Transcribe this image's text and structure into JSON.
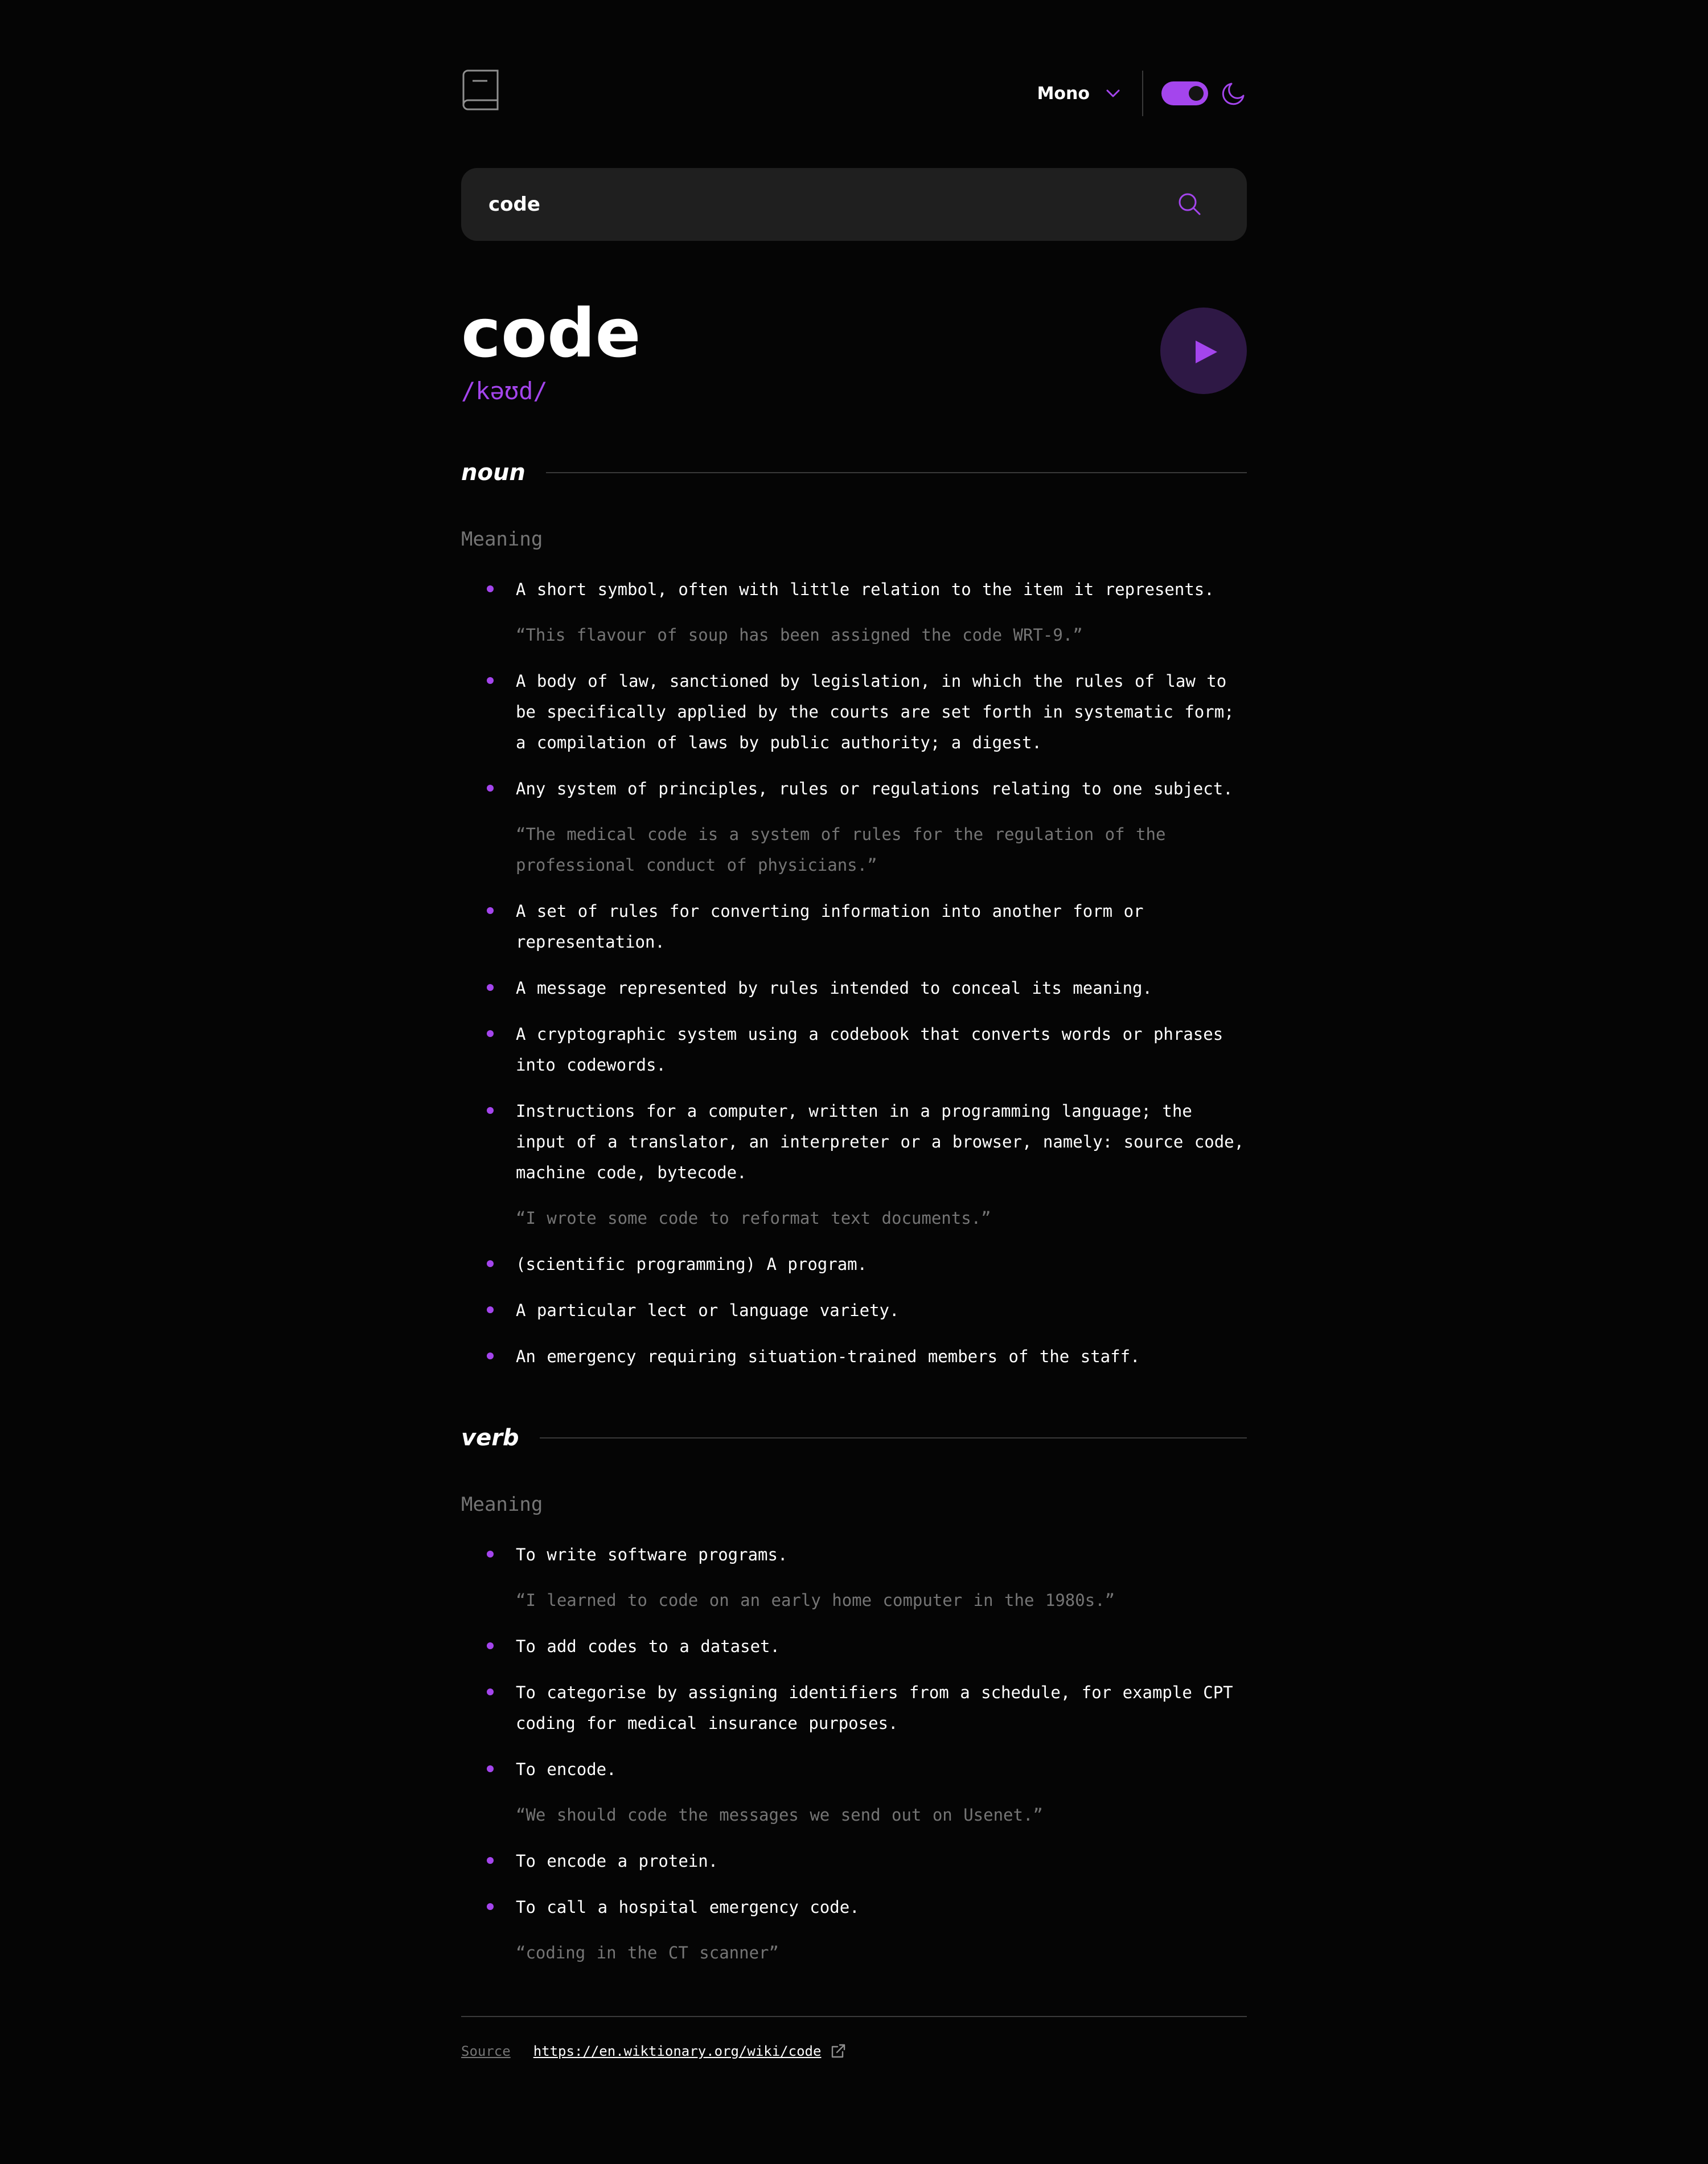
{
  "header": {
    "logo_icon": "book-icon",
    "font_selector": {
      "selected": "Mono",
      "icon": "chevron-down-icon"
    },
    "theme_toggle": {
      "state": "dark"
    },
    "theme_icon": "moon-icon",
    "accent_color": "#a445ed"
  },
  "search": {
    "value": "code",
    "placeholder": "",
    "icon": "search-icon"
  },
  "word": {
    "title": "code",
    "phonetic": "/kəʊd/",
    "play_icon": "play-icon"
  },
  "meanings": [
    {
      "part_of_speech": "noun",
      "label": "Meaning",
      "definitions": [
        {
          "text": "A short symbol, often with little relation to the item it represents.",
          "example": "“This flavour of soup has been assigned the code WRT-9.”"
        },
        {
          "text": "A body of law, sanctioned by legislation, in which the rules of law to be specifically applied by the courts are set forth in systematic form; a compilation of laws by public authority; a digest.",
          "example": ""
        },
        {
          "text": "Any system of principles, rules or regulations relating to one subject.",
          "example": "“The medical code is a system of rules for the regulation of the professional conduct of physicians.”"
        },
        {
          "text": "A set of rules for converting information into another form or representation.",
          "example": ""
        },
        {
          "text": "A message represented by rules intended to conceal its meaning.",
          "example": ""
        },
        {
          "text": "A cryptographic system using a codebook that converts words or phrases into codewords.",
          "example": ""
        },
        {
          "text": "Instructions for a computer, written in a programming language; the input of a translator, an interpreter or a browser, namely: source code, machine code, bytecode.",
          "example": "“I wrote some code to reformat text documents.”"
        },
        {
          "text": "(scientific programming) A program.",
          "example": ""
        },
        {
          "text": "A particular lect or language variety.",
          "example": ""
        },
        {
          "text": "An emergency requiring situation-trained members of the staff.",
          "example": ""
        }
      ]
    },
    {
      "part_of_speech": "verb",
      "label": "Meaning",
      "definitions": [
        {
          "text": "To write software programs.",
          "example": "“I learned to code on an early home computer in the 1980s.”"
        },
        {
          "text": "To add codes to a dataset.",
          "example": ""
        },
        {
          "text": "To categorise by assigning identifiers from a schedule, for example CPT coding for medical insurance purposes.",
          "example": ""
        },
        {
          "text": "To encode.",
          "example": "“We should code the messages we send out on Usenet.”"
        },
        {
          "text": "To encode a protein.",
          "example": ""
        },
        {
          "text": "To call a hospital emergency code.",
          "example": "“coding in the CT scanner”"
        }
      ]
    }
  ],
  "footer": {
    "source_label": "Source",
    "source_url": "https://en.wiktionary.org/wiki/code",
    "link_icon": "external-link-icon"
  }
}
